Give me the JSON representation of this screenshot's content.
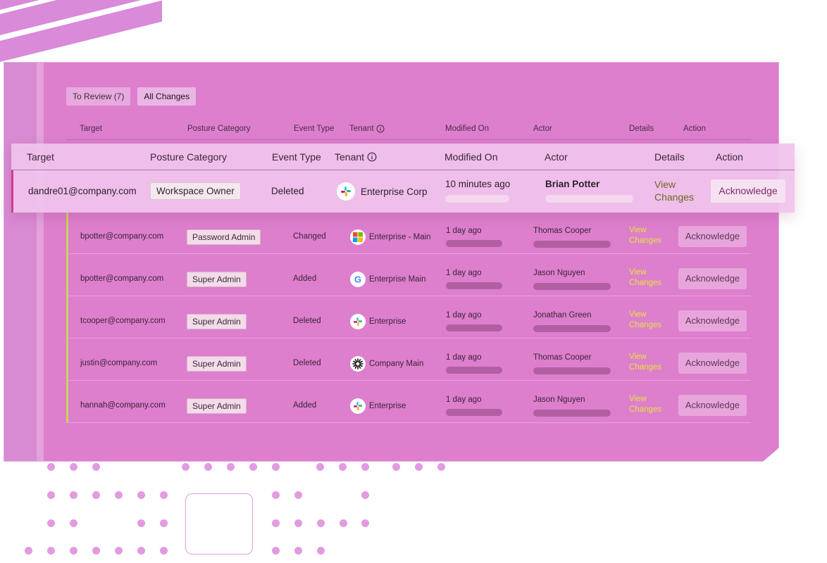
{
  "tabs": {
    "to_review": "To Review (7)",
    "all_changes": "All Changes"
  },
  "columns": {
    "target": "Target",
    "posture_category": "Posture Category",
    "event_type": "Event Type",
    "tenant": "Tenant",
    "modified_on": "Modified On",
    "actor": "Actor",
    "details": "Details",
    "action": "Action"
  },
  "highlighted_row": {
    "target": "dandre01@company.com",
    "posture_category": "Workspace Owner",
    "event_type": "Deleted",
    "tenant": "Enterprise Corp",
    "tenant_icon": "slack-icon",
    "modified_on": "10 minutes ago",
    "actor": "Brian Potter",
    "details": "View Changes",
    "action": "Acknowledge"
  },
  "rows": [
    {
      "target": "bpotter@company.com",
      "posture_category": "Password Admin",
      "event_type": "Changed",
      "tenant": "Enterprise - Main",
      "tenant_icon": "microsoft-icon",
      "modified_on": "1 day ago",
      "actor": "Thomas Cooper",
      "details": "View Changes",
      "action": "Acknowledge"
    },
    {
      "target": "bpotter@company.com",
      "posture_category": "Super Admin",
      "event_type": "Added",
      "tenant": "Enterprise Main",
      "tenant_icon": "google-icon",
      "modified_on": "1 day ago",
      "actor": "Jason Nguyen",
      "details": "View Changes",
      "action": "Acknowledge"
    },
    {
      "target": "tcooper@company.com",
      "posture_category": "Super Admin",
      "event_type": "Deleted",
      "tenant": "Enterprise",
      "tenant_icon": "slack-icon",
      "modified_on": "1 day ago",
      "actor": "Jonathan Green",
      "details": "View Changes",
      "action": "Acknowledge"
    },
    {
      "target": "justin@company.com",
      "posture_category": "Super Admin",
      "event_type": "Deleted",
      "tenant": "Company Main",
      "tenant_icon": "starburst-icon",
      "modified_on": "1 day ago",
      "actor": "Thomas Cooper",
      "details": "View Changes",
      "action": "Acknowledge"
    },
    {
      "target": "hannah@company.com",
      "posture_category": "Super Admin",
      "event_type": "Added",
      "tenant": "Enterprise",
      "tenant_icon": "slack-icon",
      "modified_on": "1 day ago",
      "actor": "Jason Nguyen",
      "details": "View Changes",
      "action": "Acknowledge"
    }
  ],
  "colors": {
    "panel": "#dd7fcd",
    "accent_yellow": "#e8e23c",
    "highlight_bar": "#d2398f"
  }
}
